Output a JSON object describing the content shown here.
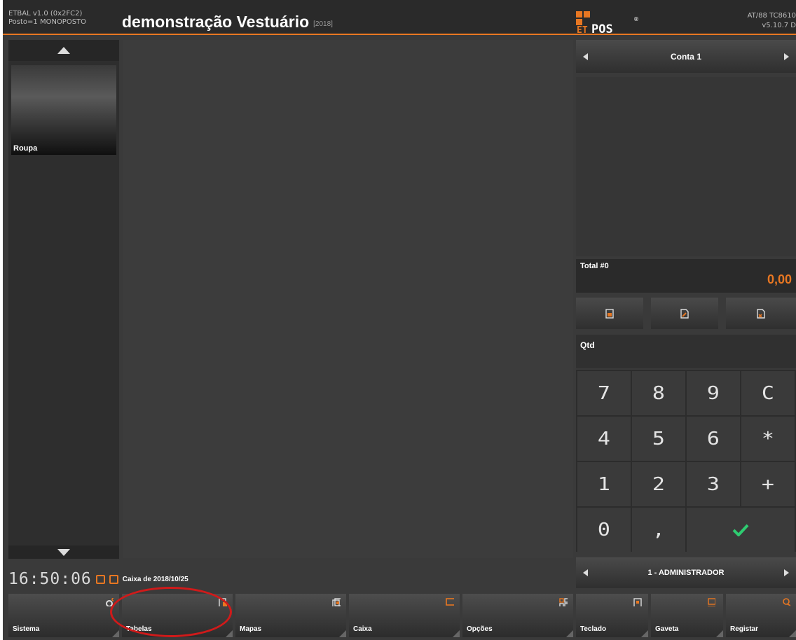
{
  "header": {
    "left_line1": "ETBAL v1.0 (0x2FC2)",
    "left_line2": "Posto=1 MONOPOSTO",
    "title": "demonstração Vestuário",
    "year": "[2018]",
    "logo": "ETPOS",
    "right_line1": "AT/88 TC8610",
    "right_line2": "v5.10.7 D"
  },
  "categories": [
    {
      "label": "Roupa"
    }
  ],
  "status": {
    "clock": "16:50:06",
    "cash_label": "Caixa de 2018/10/25"
  },
  "account": {
    "label": "Conta 1"
  },
  "total": {
    "label": "Total #0",
    "value": "0,00"
  },
  "quantity": {
    "label": "Qtd"
  },
  "keypad": {
    "keys": [
      "7",
      "8",
      "9",
      "C",
      "4",
      "5",
      "6",
      "*",
      "1",
      "2",
      "3",
      "+",
      "0",
      ","
    ]
  },
  "user": {
    "label": "1 - ADMINISTRADOR"
  },
  "functions": [
    {
      "label": "Sistema",
      "icon": "gear-icon"
    },
    {
      "label": "Tabelas",
      "icon": "tables-icon"
    },
    {
      "label": "Mapas",
      "icon": "maps-icon"
    },
    {
      "label": "Caixa",
      "icon": "cash-register-icon"
    },
    {
      "label": "Opções",
      "icon": "grid-icon"
    },
    {
      "label": "Teclado",
      "icon": "keyboard-icon"
    },
    {
      "label": "Gaveta",
      "icon": "drawer-icon"
    },
    {
      "label": "Registar",
      "icon": "user-key-icon"
    }
  ],
  "colors": {
    "accent": "#e87722",
    "confirm": "#2ecc71",
    "annotation": "#d01a1a"
  }
}
